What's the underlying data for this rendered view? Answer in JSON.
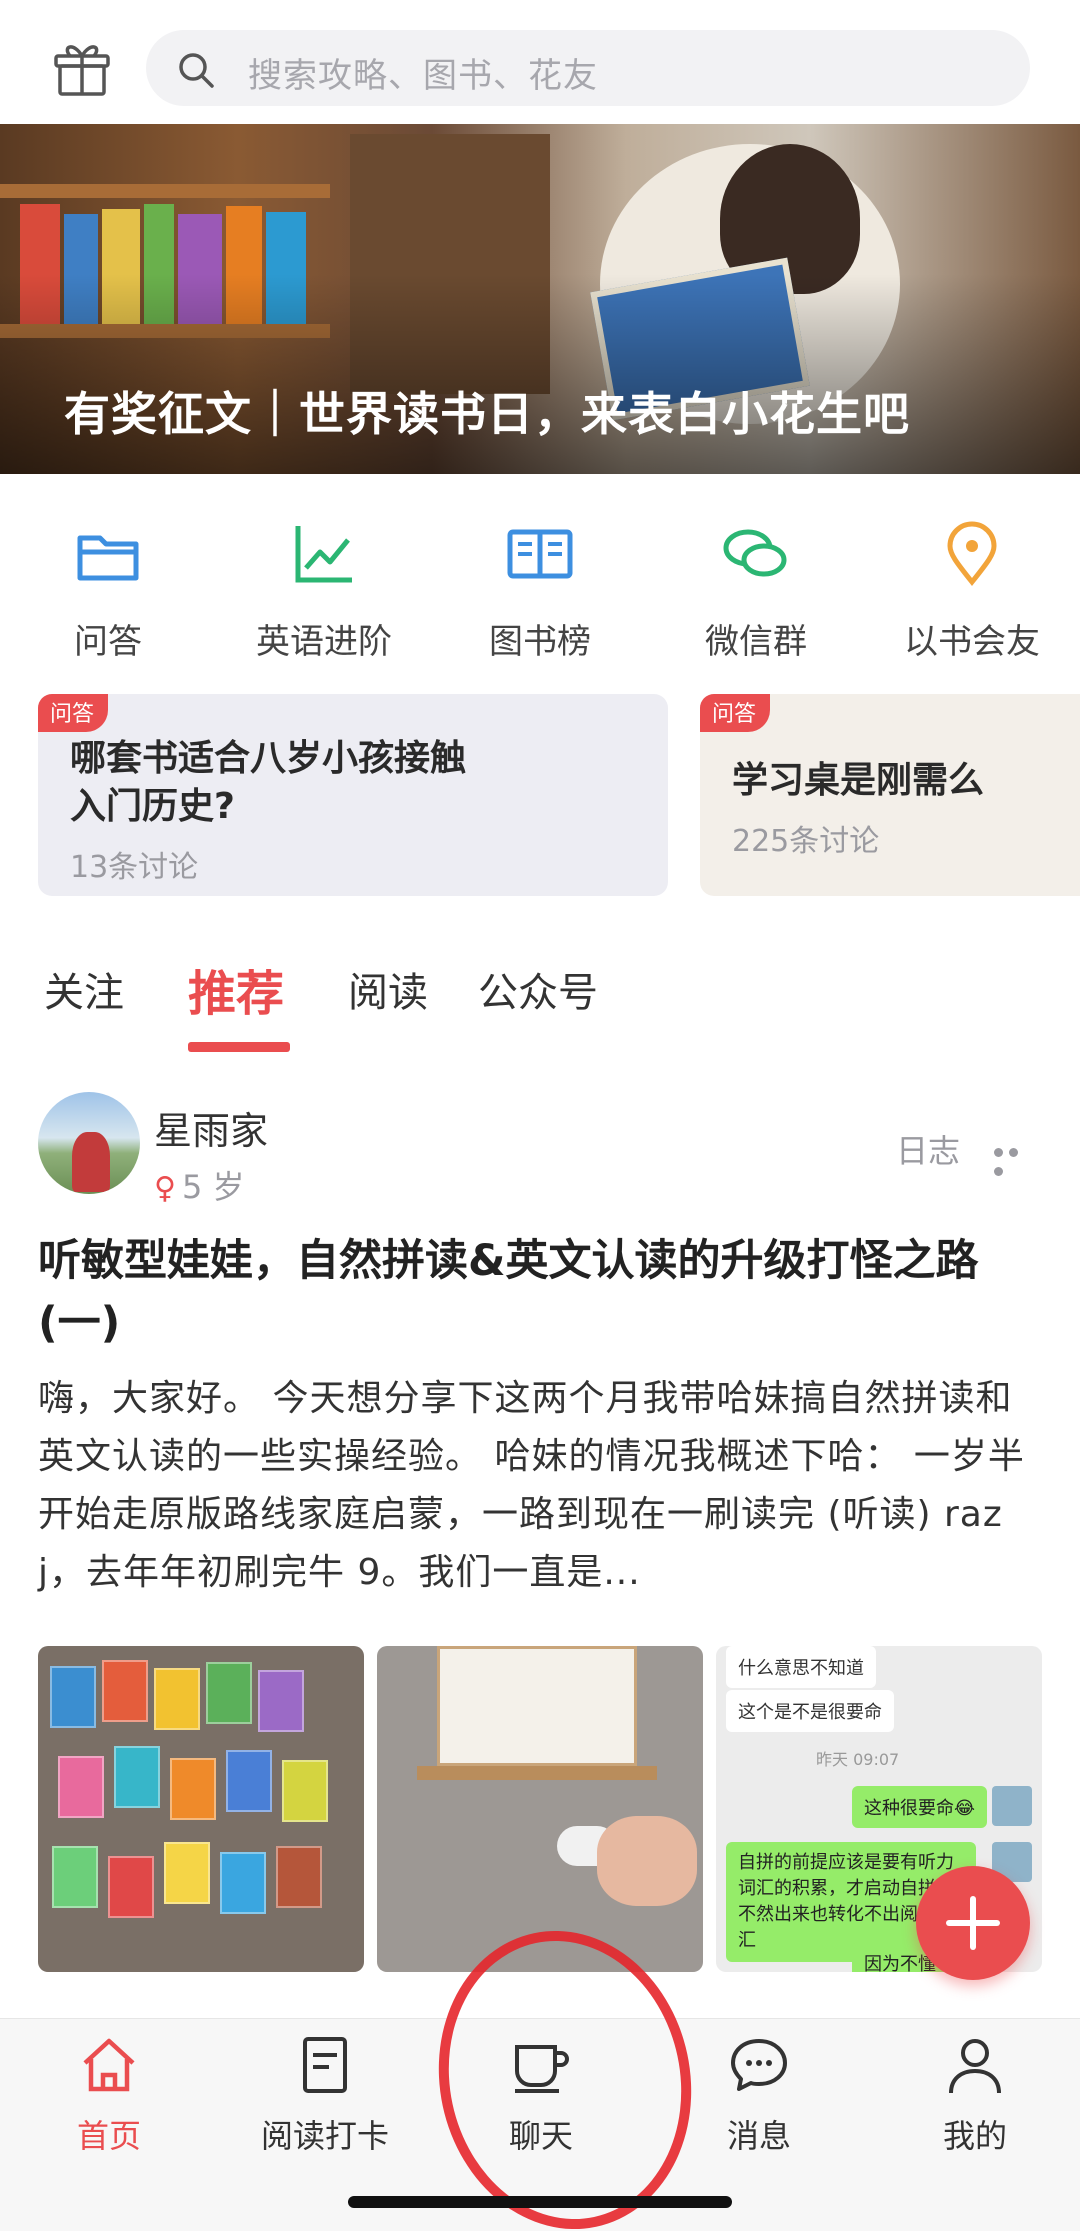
{
  "search": {
    "placeholder": "搜索攻略、图书、花友"
  },
  "banner": {
    "title": "有奖征文｜世界读书日，来表白小花生吧"
  },
  "quick_nav": [
    {
      "label": "问答",
      "icon": "folder-icon",
      "color": "#3d8fe0"
    },
    {
      "label": "英语进阶",
      "icon": "trend-chart-icon",
      "color": "#2bb673"
    },
    {
      "label": "图书榜",
      "icon": "open-book-icon",
      "color": "#3d8fe0"
    },
    {
      "label": "微信群",
      "icon": "chat-bubbles-icon",
      "color": "#2bb673"
    },
    {
      "label": "以书会友",
      "icon": "location-pin-icon",
      "color": "#f2a43a"
    }
  ],
  "cards": [
    {
      "tag": "问答",
      "title_line1": "哪套书适合八岁小孩接触",
      "title_line2": "入门历史?",
      "sub": "13条讨论"
    },
    {
      "tag": "问答",
      "title_line1": "学习桌是刚需么",
      "title_line2": "",
      "sub": "225条讨论"
    }
  ],
  "tabs": [
    {
      "label": "关注",
      "active": false
    },
    {
      "label": "推荐",
      "active": true
    },
    {
      "label": "阅读",
      "active": false
    },
    {
      "label": "公众号",
      "active": false
    }
  ],
  "post": {
    "author": "星雨家",
    "gender_symbol": "♀",
    "age": "5 岁",
    "type": "日志",
    "title": "听敏型娃娃，自然拼读&英文认读的升级打怪之路 (一)",
    "body": "嗨，大家好。 今天想分享下这两个月我带哈妹搞自然拼读和英文认读的一些实操经验。 哈妹的情况我概述下哈： 一岁半开始走原版路线家庭启蒙，一路到现在一刷读完 (听读) raz j，去年年初刷完牛 9。我们一直是...",
    "chat_lines": [
      {
        "text": "什么意思不知道",
        "side": "w"
      },
      {
        "text": "这个是不是很要命",
        "side": "w"
      },
      {
        "text": "昨天 09:07",
        "side": "time"
      },
      {
        "text": "这种很要命😂",
        "side": "g"
      },
      {
        "text": "自拼的前提应该是要有听力词汇的积累，才启动自拼，不然出来也转化不出阅读词汇",
        "side": "g"
      },
      {
        "text": "因为不懂",
        "side": "g"
      }
    ]
  },
  "bottom_nav": [
    {
      "label": "首页",
      "icon": "home-icon",
      "active": true
    },
    {
      "label": "阅读打卡",
      "icon": "note-icon",
      "active": false
    },
    {
      "label": "聊天",
      "icon": "coffee-cup-icon",
      "active": false
    },
    {
      "label": "消息",
      "icon": "message-bubble-icon",
      "active": false
    },
    {
      "label": "我的",
      "icon": "person-icon",
      "active": false
    }
  ],
  "colors": {
    "accent": "#ea4d4f",
    "blue": "#3d8fe0",
    "green": "#2bb673",
    "orange": "#f2a43a"
  }
}
